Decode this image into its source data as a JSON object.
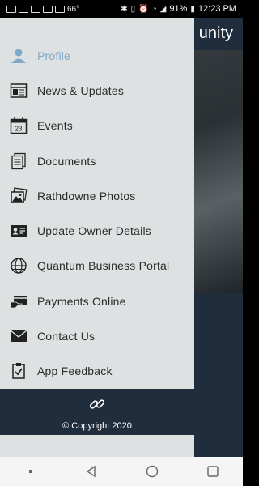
{
  "status_bar": {
    "battery": "91%",
    "time": "12:23 PM",
    "notif_text": "66°"
  },
  "app": {
    "title_fragment": "unity"
  },
  "drawer": {
    "items": [
      {
        "label": "Profile",
        "icon": "person-icon",
        "active": true
      },
      {
        "label": "News & Updates",
        "icon": "newspaper-icon"
      },
      {
        "label": "Events",
        "icon": "calendar-icon",
        "calendar_day": "23"
      },
      {
        "label": "Documents",
        "icon": "documents-icon"
      },
      {
        "label": "Rathdowne Photos",
        "icon": "photos-icon"
      },
      {
        "label": "Update Owner Details",
        "icon": "id-card-icon"
      },
      {
        "label": "Quantum Business Portal",
        "icon": "globe-icon"
      },
      {
        "label": "Payments Online",
        "icon": "payment-icon"
      },
      {
        "label": "Contact Us",
        "icon": "envelope-icon"
      },
      {
        "label": "App Feedback",
        "icon": "clipboard-check-icon"
      }
    ],
    "footer": {
      "copyright": "© Copyright 2020"
    }
  },
  "colors": {
    "drawer_bg": "#dde1e2",
    "active": "#7fa9c7",
    "dark": "#1f2d3d"
  }
}
